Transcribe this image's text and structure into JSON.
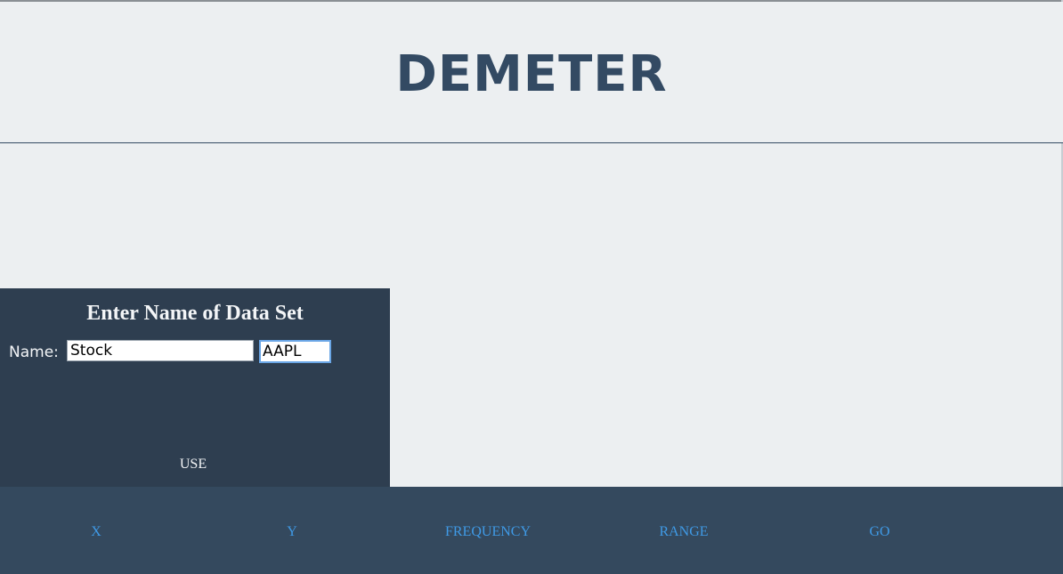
{
  "header": {
    "title": "DEMETER"
  },
  "dataset_panel": {
    "heading": "Enter Name of Data Set",
    "name_label": "Name:",
    "name_value": "Stock",
    "ticker_value": "AAPL",
    "use_label": "USE"
  },
  "footer": {
    "nav": [
      "X",
      "Y",
      "FREQUENCY",
      "RANGE",
      "GO"
    ]
  },
  "colors": {
    "page_background": "#eceff1",
    "title": "#334a63",
    "panel_background": "#2e3e50",
    "footer_background": "#34495e",
    "nav_link": "#3f9ae6",
    "focus_border": "#6aa6e6"
  }
}
